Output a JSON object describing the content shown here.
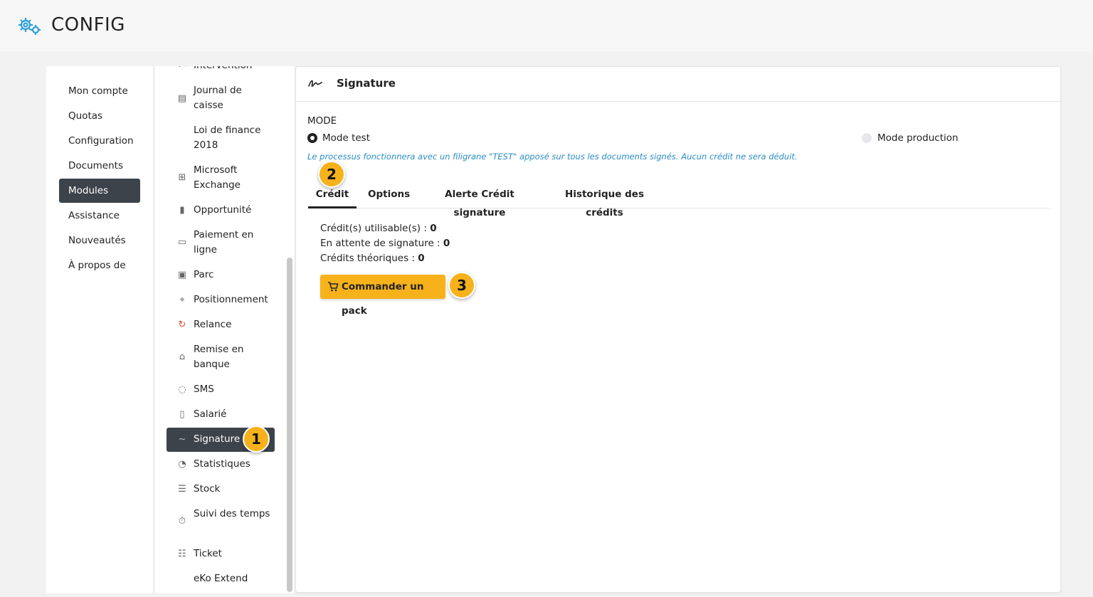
{
  "header": {
    "title": "CONFIG",
    "logo_icon": "gears-icon",
    "accent": "#2b9fd9"
  },
  "left_menu": {
    "items": [
      {
        "label": "Mon compte"
      },
      {
        "label": "Quotas"
      },
      {
        "label": "Configuration"
      },
      {
        "label": "Documents"
      },
      {
        "label": "Modules",
        "active": true
      },
      {
        "label": "Assistance"
      },
      {
        "label": "Nouveautés"
      },
      {
        "label": "À propos de"
      }
    ]
  },
  "modules": {
    "items": [
      {
        "label": "Intervention",
        "icon": "tools-icon"
      },
      {
        "label": "Journal de caisse",
        "icon": "cash-register-icon"
      },
      {
        "label": "Loi de finance 2018",
        "icon": ""
      },
      {
        "label": "Microsoft Exchange",
        "icon": "windows-icon"
      },
      {
        "label": "Opportunité",
        "icon": "bars-icon"
      },
      {
        "label": "Paiement en ligne",
        "icon": "credit-card-icon"
      },
      {
        "label": "Parc",
        "icon": "box-icon"
      },
      {
        "label": "Positionnement",
        "icon": "map-icon"
      },
      {
        "label": "Relance",
        "icon": "refresh-icon"
      },
      {
        "label": "Remise en banque",
        "icon": "bank-icon"
      },
      {
        "label": "SMS",
        "icon": "sms-icon"
      },
      {
        "label": "Salarié",
        "icon": "badge-icon"
      },
      {
        "label": "Signature",
        "icon": "signature-icon",
        "active": true
      },
      {
        "label": "Statistiques",
        "icon": "pie-chart-icon"
      },
      {
        "label": "Stock",
        "icon": "stock-icon"
      },
      {
        "label": "Suivi des temps",
        "icon": "stopwatch-icon"
      },
      {
        "label": "Ticket",
        "icon": "list-check-icon"
      },
      {
        "label": "eKo Extend",
        "icon": ""
      }
    ]
  },
  "panel": {
    "title": "Signature",
    "mode_label": "MODE",
    "mode_test": "Mode test",
    "mode_production": "Mode production",
    "hint": "Le processus fonctionnera avec un filigrane \"TEST\" apposé sur tous les documents signés. Aucun crédit ne sera déduit.",
    "tabs": [
      {
        "label": "Crédit",
        "active": true
      },
      {
        "label": "Options"
      },
      {
        "label": "Alerte Crédit signature"
      },
      {
        "label": "Historique des crédits"
      }
    ],
    "credits": {
      "usable_label": "Crédit(s) utilisable(s) : ",
      "usable_value": "0",
      "pending_label": "En attente de signature : ",
      "pending_value": "0",
      "theoretical_label": "Crédits théoriques : ",
      "theoretical_value": "0"
    },
    "order_button": "Commander un pack"
  },
  "steps": [
    "1",
    "2",
    "3"
  ],
  "colors": {
    "active_bg": "#3d434a",
    "button": "#f7b21b",
    "hint": "#2b8cc4",
    "relance_icon": "#e04b2b"
  }
}
